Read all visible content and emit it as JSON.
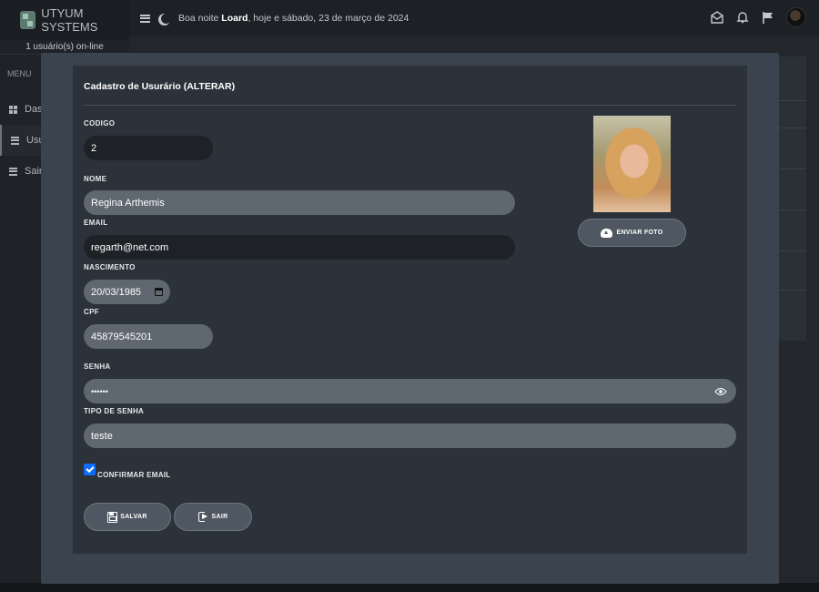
{
  "app": {
    "brand": "UTYUM SYSTEMS",
    "online_count": "1 usuário(s) on-line",
    "menu_title": "MENU",
    "nav": [
      {
        "label": "Dash",
        "icon": "dashboard-icon"
      },
      {
        "label": "Usu",
        "icon": "list-icon"
      },
      {
        "label": "Sair",
        "icon": "list-icon"
      }
    ],
    "greeting": {
      "prefix": "Boa noite ",
      "user": "Loard",
      "suffix": ", hoje e sábado, 23 de março de 2024"
    },
    "top_icons": [
      "envelope-icon",
      "bell-icon",
      "flag-icon",
      "avatar"
    ]
  },
  "modal": {
    "title": "Cadastro de Usurário (ALTERAR)",
    "fields": {
      "codigo": {
        "label": "CODIGO",
        "value": "2"
      },
      "nome": {
        "label": "NOME",
        "value": "Regina Arthemis"
      },
      "email": {
        "label": "EMAIL",
        "value": "regarth@net.com"
      },
      "nascimento": {
        "label": "NASCIMENTO",
        "value": "20/03/1985"
      },
      "cpf": {
        "label": "CPF",
        "value": "45879545201"
      },
      "senha": {
        "label": "SENHA",
        "value": "••••••"
      },
      "tipo_senha": {
        "label": "TIPO DE SENHA",
        "value": "teste"
      }
    },
    "confirm_email": {
      "label": "CONFIRMAR EMAIL",
      "checked": true
    },
    "upload_button": "ENVIAR FOTO",
    "save_button": "SALVAR",
    "exit_button": "SAIR"
  },
  "colors": {
    "accent_checkbox": "#0d6efd",
    "modal_bg": "#3a434e",
    "card_bg": "#2c323a"
  }
}
